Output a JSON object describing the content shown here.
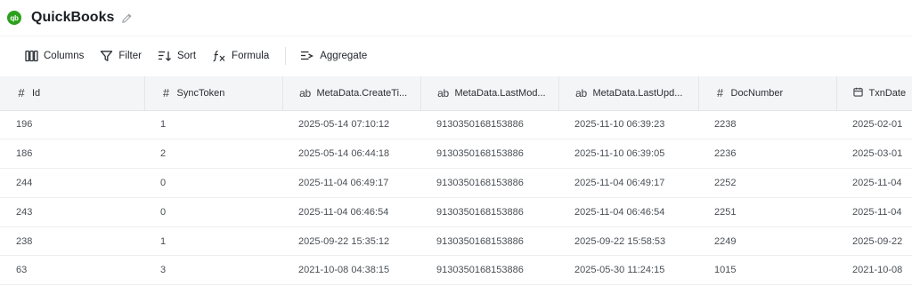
{
  "app": {
    "title": "QuickBooks",
    "logo_text": "qb"
  },
  "toolbar": {
    "columns_label": "Columns",
    "filter_label": "Filter",
    "sort_label": "Sort",
    "formula_label": "Formula",
    "aggregate_label": "Aggregate"
  },
  "table": {
    "headers": [
      {
        "icon": "#",
        "label": "Id"
      },
      {
        "icon": "#",
        "label": "SyncToken"
      },
      {
        "icon": "ab",
        "label": "MetaData.CreateTi..."
      },
      {
        "icon": "ab",
        "label": "MetaData.LastMod..."
      },
      {
        "icon": "ab",
        "label": "MetaData.LastUpd..."
      },
      {
        "icon": "#",
        "label": "DocNumber"
      },
      {
        "icon": "cal",
        "label": "TxnDate"
      }
    ],
    "rows": [
      [
        "196",
        "1",
        "2025-05-14 07:10:12",
        "9130350168153886",
        "2025-11-10 06:39:23",
        "2238",
        "2025-02-01"
      ],
      [
        "186",
        "2",
        "2025-05-14 06:44:18",
        "9130350168153886",
        "2025-11-10 06:39:05",
        "2236",
        "2025-03-01"
      ],
      [
        "244",
        "0",
        "2025-11-04 06:49:17",
        "9130350168153886",
        "2025-11-04 06:49:17",
        "2252",
        "2025-11-04"
      ],
      [
        "243",
        "0",
        "2025-11-04 06:46:54",
        "9130350168153886",
        "2025-11-04 06:46:54",
        "2251",
        "2025-11-04"
      ],
      [
        "238",
        "1",
        "2025-09-22 15:35:12",
        "9130350168153886",
        "2025-09-22 15:58:53",
        "2249",
        "2025-09-22"
      ],
      [
        "63",
        "3",
        "2021-10-08 04:38:15",
        "9130350168153886",
        "2025-05-30 11:24:15",
        "1015",
        "2021-10-08"
      ]
    ]
  },
  "colors": {
    "brand": "#2ca01c",
    "header_bg": "#f4f5f7"
  }
}
